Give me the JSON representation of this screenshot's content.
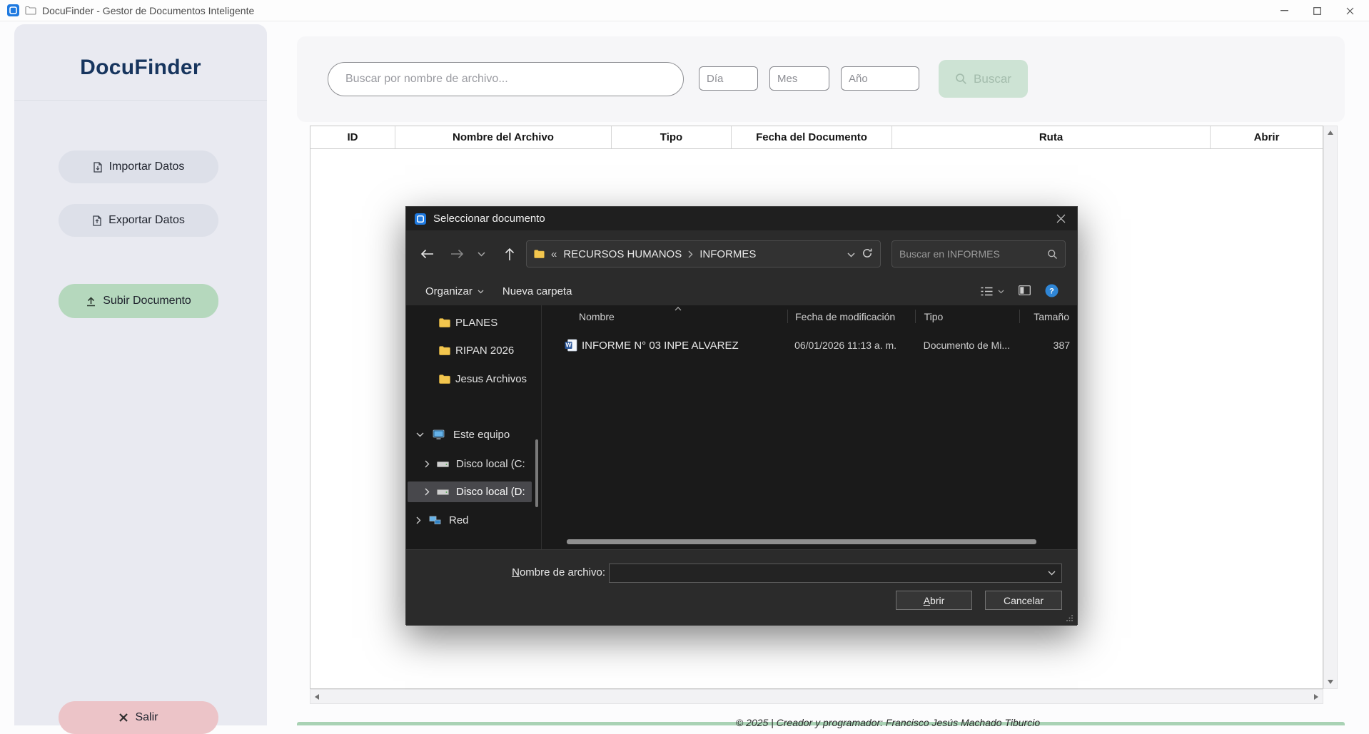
{
  "window": {
    "title": "DocuFinder - Gestor de Documentos Inteligente"
  },
  "colors": {
    "brand_navy": "#17355e",
    "sidebar_bg": "#e9eaf1",
    "green_accent": "#b5d8bd",
    "red_accent": "#ecc4c8",
    "buscar_bg": "#cde3d4",
    "dialog_bg": "#2b2b2b",
    "selection_gray": "#48484c",
    "folder_yellow": "#f3c64e",
    "word_blue": "#2b579a",
    "help_blue": "#2f86d6"
  },
  "sidebar": {
    "brand": "DocuFinder",
    "items": [
      {
        "label": "Importar Datos"
      },
      {
        "label": "Exportar Datos"
      },
      {
        "label": "Subir Documento"
      },
      {
        "label": "Salir"
      }
    ]
  },
  "search": {
    "placeholder": "Buscar por nombre de archivo...",
    "day": "Día",
    "month": "Mes",
    "year": "Año",
    "button": "Buscar"
  },
  "table": {
    "columns": [
      "ID",
      "Nombre del Archivo",
      "Tipo",
      "Fecha del Documento",
      "Ruta",
      "Abrir"
    ]
  },
  "footer": {
    "text": "© 2025 | Creador y programador: Francisco Jesús Machado Tiburcio"
  },
  "dialog": {
    "title": "Seleccionar documento",
    "address": {
      "overflow": "«",
      "crumbs": [
        "RECURSOS HUMANOS",
        "INFORMES"
      ]
    },
    "search_placeholder": "Buscar en INFORMES",
    "toolbar": {
      "organize": "Organizar",
      "new_folder": "Nueva carpeta"
    },
    "tree": [
      {
        "label": "PLANES"
      },
      {
        "label": "RIPAN 2026"
      },
      {
        "label": "Jesus Archivos"
      },
      {
        "label": "Este equipo"
      },
      {
        "label": "Disco local (C:"
      },
      {
        "label": "Disco local (D:"
      },
      {
        "label": "Red"
      }
    ],
    "list": {
      "columns": [
        "Nombre",
        "Fecha de modificación",
        "Tipo",
        "Tamaño"
      ],
      "rows": [
        {
          "name": "INFORME N° 03 INPE ALVAREZ",
          "modified": "06/01/2026 11:13 a. m.",
          "type": "Documento de Mi...",
          "size": "387"
        }
      ]
    },
    "filename": {
      "accel": "N",
      "rest": "ombre de archivo:",
      "value": ""
    },
    "buttons": {
      "open_accel": "A",
      "open_rest": "brir",
      "cancel": "Cancelar"
    }
  }
}
